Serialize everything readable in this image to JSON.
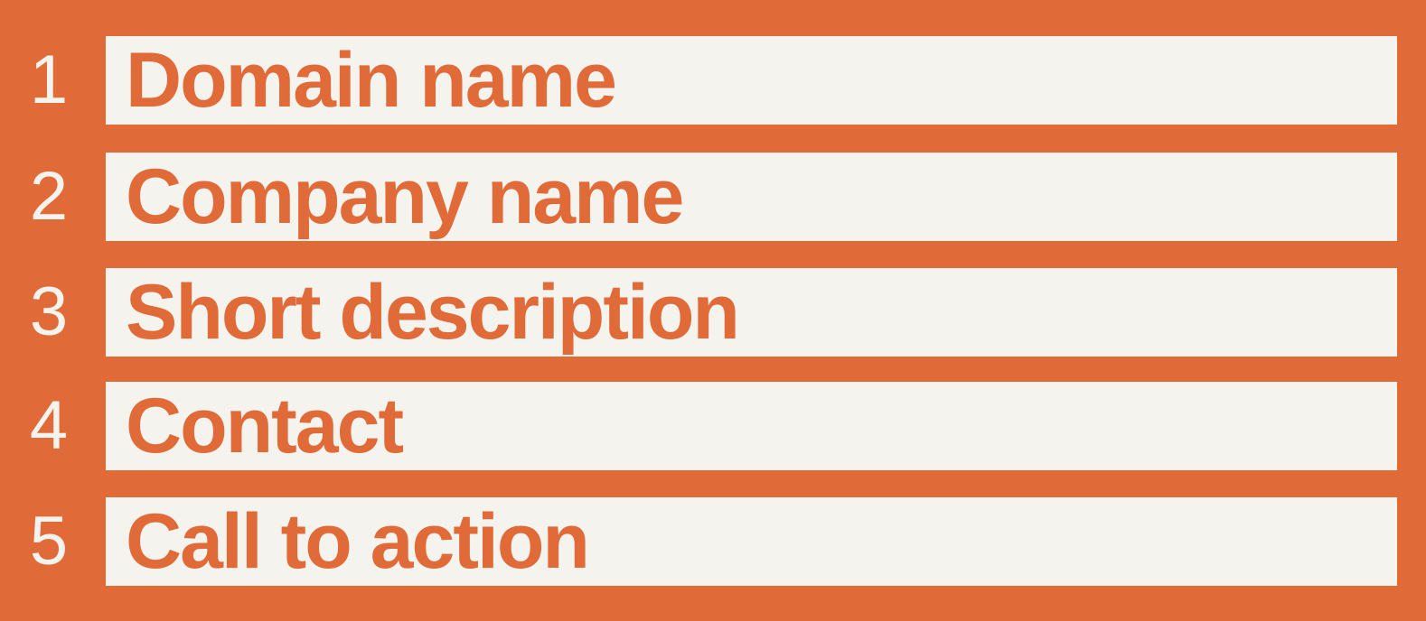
{
  "colors": {
    "background": "#e06a38",
    "bar": "#f4f3ee",
    "number_text": "#f4f3ee",
    "label_text": "#e06a38"
  },
  "items": [
    {
      "number": "1",
      "label": "Domain name"
    },
    {
      "number": "2",
      "label": "Company name"
    },
    {
      "number": "3",
      "label": "Short description"
    },
    {
      "number": "4",
      "label": "Contact"
    },
    {
      "number": "5",
      "label": "Call to action"
    }
  ]
}
